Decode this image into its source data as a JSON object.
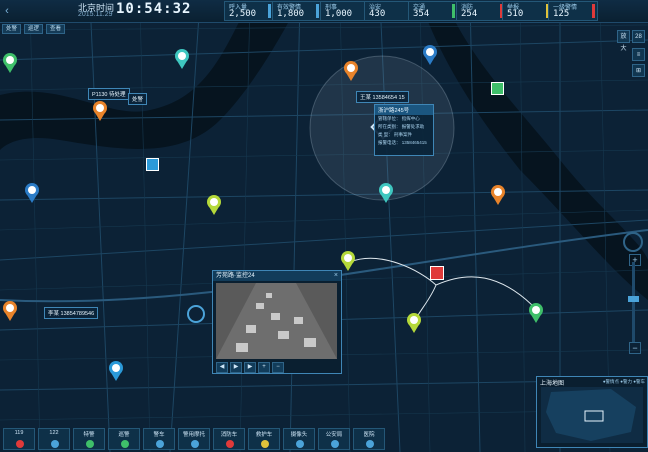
{
  "header": {
    "clock_label": "北京时间",
    "date": "2015.11.29",
    "time": "10:54:32",
    "stats": [
      {
        "label": "呼入量",
        "value": "2,500",
        "color": "#4ba3d9"
      },
      {
        "label": "有效警情",
        "value": "1,800",
        "color": "#4ba3d9"
      },
      {
        "label": "刑事",
        "value": "1,000",
        "color": "#4ba3d9"
      },
      {
        "label": "治安",
        "value": "430",
        "color": "#4ba3d9"
      },
      {
        "label": "交通",
        "value": "354",
        "color": "#3fbf6a"
      },
      {
        "label": "消防",
        "value": "254",
        "color": "#e03a3a"
      },
      {
        "label": "举报",
        "value": "510",
        "color": "#e0c23a"
      },
      {
        "label": "一级警情",
        "value": "125",
        "color": "#e03a3a"
      }
    ]
  },
  "filters": [
    "处警",
    "巡逻",
    "查看"
  ],
  "side": {
    "btn_top": "放大",
    "btn_num": "28"
  },
  "popup": {
    "title": "浙沪路245号",
    "rows": [
      "管辖单位：  指挥中心",
      "所在类别：  报警处求助",
      "类    型：  刑事案件",
      "报警电话：  1358465415"
    ]
  },
  "tags": {
    "caller": "王某 13584654 15",
    "police": "P1130",
    "police_sub": "待处理",
    "police_label": "处警",
    "caller2": "李某 13854789546"
  },
  "video": {
    "title": "芳苑路·监控24",
    "close": "×",
    "controls": [
      "◀",
      "▶",
      "▶",
      "+",
      "−"
    ]
  },
  "minimap": {
    "title": "上海地图",
    "legend": "●警情点 ●警力 ●警车"
  },
  "bottom": [
    {
      "label": "119",
      "color": "#e03a3a"
    },
    {
      "label": "122",
      "color": "#4ba3d9"
    },
    {
      "label": "特警",
      "color": "#3fbf6a"
    },
    {
      "label": "巡警",
      "color": "#3fbf6a"
    },
    {
      "label": "警车",
      "color": "#4ba3d9"
    },
    {
      "label": "警用摩托",
      "color": "#4ba3d9"
    },
    {
      "label": "消防车",
      "color": "#e03a3a"
    },
    {
      "label": "救护车",
      "color": "#e0c23a"
    },
    {
      "label": "摄像头",
      "color": "#4ba3d9"
    },
    {
      "label": "公安局",
      "color": "#4ba3d9"
    },
    {
      "label": "医院",
      "color": "#4ba3d9"
    }
  ]
}
